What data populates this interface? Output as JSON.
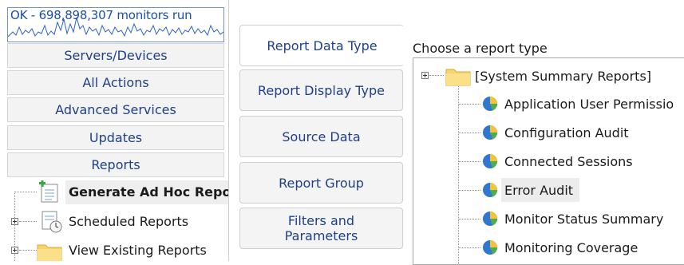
{
  "status": {
    "text": "OK - 698,898,307 monitors run"
  },
  "nav": [
    {
      "label": "Servers/Devices"
    },
    {
      "label": "All Actions"
    },
    {
      "label": "Advanced Services"
    },
    {
      "label": "Updates"
    },
    {
      "label": "Reports"
    }
  ],
  "left_tree": [
    {
      "label": "Generate Ad Hoc Reports",
      "selected": true,
      "icon": "new-report-icon"
    },
    {
      "label": "Scheduled Reports",
      "icon": "scheduled-report-icon"
    },
    {
      "label": "View Existing Reports",
      "icon": "folder-icon"
    }
  ],
  "tabs": [
    {
      "lines": [
        "Report Data Type"
      ],
      "active": true
    },
    {
      "lines": [
        "Report Display Type"
      ]
    },
    {
      "lines": [
        "Source Data"
      ]
    },
    {
      "lines": [
        "Report Group"
      ]
    },
    {
      "lines": [
        "Filters and",
        "Parameters"
      ]
    }
  ],
  "panel": {
    "choose_label": "Choose a report type",
    "root": {
      "label": "[System Summary Reports]",
      "icon": "folder-icon"
    },
    "items": [
      {
        "label": "Application User Permissio",
        "icon": "pie-chart-icon"
      },
      {
        "label": "Configuration Audit",
        "icon": "pie-chart-icon"
      },
      {
        "label": "Connected Sessions",
        "icon": "pie-chart-icon"
      },
      {
        "label": "Error Audit",
        "icon": "pie-chart-icon",
        "highlighted": true
      },
      {
        "label": "Monitor Status Summary",
        "icon": "pie-chart-icon"
      },
      {
        "label": "Monitoring Coverage",
        "icon": "pie-chart-icon"
      }
    ]
  },
  "colors": {
    "link": "#1e3f8a",
    "status": "#1b4fa8",
    "highlight": "#ececec"
  }
}
